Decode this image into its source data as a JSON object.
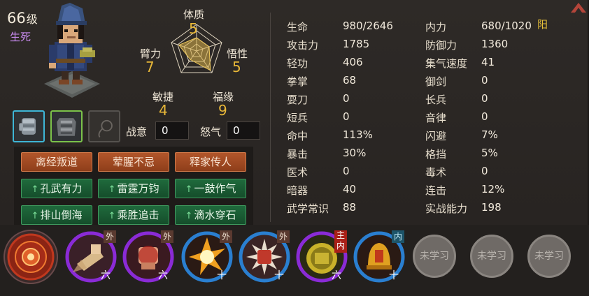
{
  "character": {
    "level_num": "66",
    "level_unit": "级",
    "status": "生死"
  },
  "attributes": {
    "tizhi": {
      "label": "体质",
      "value": "5"
    },
    "bili": {
      "label": "臂力",
      "value": "7"
    },
    "wuxing": {
      "label": "悟性",
      "value": "5"
    },
    "minjie": {
      "label": "敏捷",
      "value": "4"
    },
    "fuyuan": {
      "label": "福缘",
      "value": "9"
    }
  },
  "meters": {
    "zhanyi": {
      "label": "战意",
      "value": "0"
    },
    "nuqi": {
      "label": "怒气",
      "value": "0"
    }
  },
  "traits": [
    {
      "label": "离经叛道",
      "kind": "red"
    },
    {
      "label": "荤腥不忌",
      "kind": "red"
    },
    {
      "label": "释家传人",
      "kind": "red"
    },
    {
      "label": "孔武有力",
      "kind": "green"
    },
    {
      "label": "雷霆万钧",
      "kind": "green"
    },
    {
      "label": "一鼓作气",
      "kind": "green"
    },
    {
      "label": "排山倒海",
      "kind": "green"
    },
    {
      "label": "乘胜追击",
      "kind": "green"
    },
    {
      "label": "滴水穿石",
      "kind": "green"
    }
  ],
  "trait_arrow": "↑",
  "stats_left": [
    {
      "label": "生命",
      "value": "980/2646"
    },
    {
      "label": "攻击力",
      "value": "1785"
    },
    {
      "label": "轻功",
      "value": "406"
    },
    {
      "label": "拳掌",
      "value": "68"
    },
    {
      "label": "耍刀",
      "value": "0"
    },
    {
      "label": "短兵",
      "value": "0"
    },
    {
      "label": "命中",
      "value": "113%"
    },
    {
      "label": "暴击",
      "value": "30%"
    },
    {
      "label": "医术",
      "value": "0"
    },
    {
      "label": "暗器",
      "value": "40"
    },
    {
      "label": "武学常识",
      "value": "88"
    }
  ],
  "stats_right": [
    {
      "label": "内力",
      "value": "680/1020"
    },
    {
      "label": "防御力",
      "value": "1360"
    },
    {
      "label": "集气速度",
      "value": "41"
    },
    {
      "label": "御剑",
      "value": "0"
    },
    {
      "label": "长兵",
      "value": "0"
    },
    {
      "label": "音律",
      "value": "0"
    },
    {
      "label": "闪避",
      "value": "7%"
    },
    {
      "label": "格挡",
      "value": "5%"
    },
    {
      "label": "毒术",
      "value": "0"
    },
    {
      "label": "连击",
      "value": "12%"
    },
    {
      "label": "实战能力",
      "value": "198"
    }
  ],
  "alignment": "阳",
  "skills": [
    {
      "tag": "",
      "rank": "",
      "icon": "mandala-skill-icon",
      "ring": "#7a1a12"
    },
    {
      "tag": "外",
      "rank": "六",
      "icon": "palm-strike-icon",
      "ring": "#8a2bd6"
    },
    {
      "tag": "外",
      "rank": "六",
      "icon": "fist-blood-icon",
      "ring": "#8a2bd6"
    },
    {
      "tag": "外",
      "rank": "十",
      "icon": "explosion-icon",
      "ring": "#2a7fd0"
    },
    {
      "tag": "外",
      "rank": "十",
      "icon": "fist-burst-icon",
      "ring": "#2a7fd0"
    },
    {
      "tag": "主内",
      "rank": "六",
      "icon": "golden-orb-icon",
      "ring": "#8a2bd6"
    },
    {
      "tag": "内",
      "rank": "十",
      "icon": "golden-bell-icon",
      "ring": "#2a7fd0"
    }
  ],
  "unlearned": [
    "未学习",
    "未学习",
    "未学习"
  ],
  "colors": {
    "attribute_value": "#e9b838",
    "status_purple": "#c98bf0",
    "trait_red": "#b2562b",
    "trait_green": "#1f6a3c",
    "yang": "#e7c03a"
  }
}
